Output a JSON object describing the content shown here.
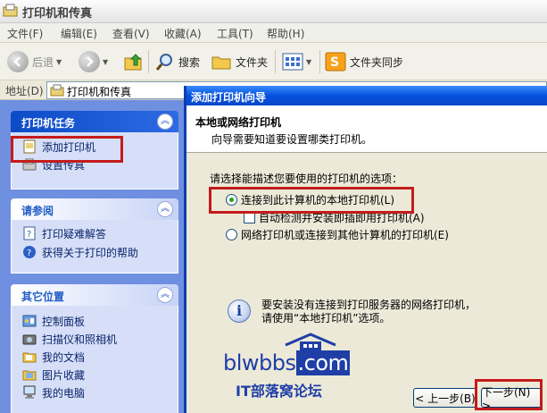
{
  "window": {
    "title": "打印机和传真"
  },
  "menu": [
    "文件(F)",
    "编辑(E)",
    "查看(V)",
    "收藏(A)",
    "工具(T)",
    "帮助(H)"
  ],
  "toolbar": {
    "back": "后退",
    "search": "搜索",
    "folders": "文件夹",
    "sync": "文件夹同步"
  },
  "address": {
    "label": "地址(D)",
    "value": "打印机和传真"
  },
  "sidebar": {
    "printer_tasks": {
      "title": "打印机任务",
      "items": [
        "添加打印机",
        "设置传真"
      ]
    },
    "see_also": {
      "title": "请参阅",
      "items": [
        "打印疑难解答",
        "获得关于打印的帮助"
      ]
    },
    "other_places": {
      "title": "其它位置",
      "items": [
        "控制面板",
        "扫描仪和照相机",
        "我的文档",
        "图片收藏",
        "我的电脑"
      ]
    }
  },
  "wizard": {
    "title": "添加打印机向导",
    "header_title": "本地或网络打印机",
    "header_desc": "向导需要知道要设置哪类打印机。",
    "prompt": "请选择能描述您要使用的打印机的选项：",
    "option_local": "连接到此计算机的本地打印机(L)",
    "option_autodetect": "自动检测并安装即插即用打印机(A)",
    "option_network": "网络打印机或连接到其他计算机的打印机(E)",
    "info_line1": "要安装没有连接到打印服务器的网络打印机，",
    "info_line2": "请使用“本地打印机”选项。",
    "back_button": "< 上一步(B)",
    "next_button": "下一步(N) >",
    "selected_option": "local"
  },
  "watermark": {
    "site": "blwbbs",
    "tld": ".com",
    "subtitle": "IT部落窝论坛"
  },
  "colors": {
    "sidebar_bg": "#6f8fe0",
    "panel_bg": "#d6dff7",
    "wizard_title": "#0551e0",
    "highlight": "#c41b1b"
  }
}
